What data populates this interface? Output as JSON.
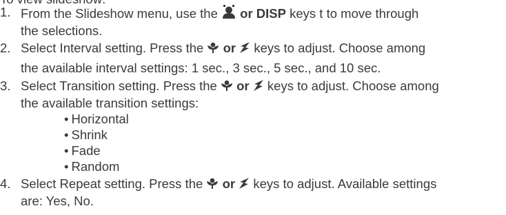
{
  "heading": "To view slideshow:",
  "steps": [
    {
      "num": "1.",
      "l1a": "From the Slideshow menu, use the",
      "l1b": "or DISP",
      "l1c": "keys t to move through",
      "l2": "the selections."
    },
    {
      "num": "2.",
      "l1a": "Select Interval setting. Press the",
      "l1b": "or",
      "l1c": "keys to adjust. Choose among",
      "l2": "the available interval settings: 1 sec., 3 sec., 5 sec., and 10 sec."
    },
    {
      "num": "3.",
      "l1a": "Select Transition setting. Press the",
      "l1b": "or",
      "l1c": "keys to adjust. Choose among",
      "l2": "the available transition settings:",
      "options": [
        "Horizontal",
        "Shrink",
        "Fade",
        "Random"
      ]
    },
    {
      "num": "4.",
      "l1a": "Select Repeat setting. Press the",
      "l1b": "or",
      "l1c": "keys to adjust. Available settings",
      "l2": "are: Yes, No."
    }
  ],
  "icons": [
    "self-timer-face-icon",
    "macro-flower-icon",
    "flash-bolt-icon"
  ],
  "colors": {
    "text": "#3a3a3a",
    "background": "#ffffff"
  }
}
